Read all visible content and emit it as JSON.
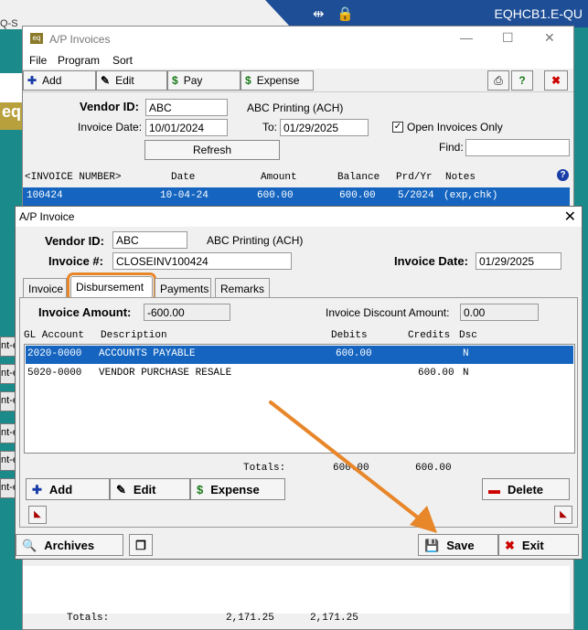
{
  "desktop": {
    "title": "EQHCB1.E-QU",
    "left_label": "Q-S",
    "left_gold": "eq",
    "side_tabs": [
      "nt-e",
      "nt-e",
      "nt-e",
      "nt-e",
      "nt-e",
      "nt-e"
    ]
  },
  "main_window": {
    "title": "A/P Invoices",
    "menu": [
      "File",
      "Program",
      "Sort"
    ],
    "toolbar": {
      "add": "Add",
      "edit": "Edit",
      "pay": "Pay",
      "expense": "Expense"
    },
    "vendor_id_label": "Vendor ID:",
    "vendor_id": "ABC",
    "vendor_name": "ABC Printing (ACH)",
    "invoice_date_label": "Invoice Date:",
    "invoice_date_from": "10/01/2024",
    "to_label": "To:",
    "invoice_date_to": "01/29/2025",
    "open_only_label": "Open Invoices Only",
    "open_only_checked": true,
    "refresh_label": "Refresh",
    "find_label": "Find:",
    "find_value": "",
    "columns": [
      "<INVOICE NUMBER>",
      "Date",
      "Amount",
      "Balance",
      "Prd/Yr",
      "Notes"
    ],
    "rows": [
      {
        "invoice": "100424",
        "date": "10-04-24",
        "amount": "600.00",
        "balance": "600.00",
        "prdyr": "5/2024",
        "notes": "(exp,chk)"
      }
    ],
    "totals_label": "Totals:",
    "totals_amount": "2,171.25",
    "totals_balance": "2,171.25"
  },
  "dialog": {
    "title": "A/P Invoice",
    "vendor_id_label": "Vendor ID:",
    "vendor_id": "ABC",
    "vendor_name": "ABC Printing (ACH)",
    "invoice_no_label": "Invoice #:",
    "invoice_no": "CLOSEINV100424",
    "invoice_date_label": "Invoice Date:",
    "invoice_date": "01/29/2025",
    "tabs": [
      "Invoice",
      "Disbursement",
      "Payments",
      "Remarks"
    ],
    "active_tab": "Disbursement",
    "invoice_amount_label": "Invoice Amount:",
    "invoice_amount": "-600.00",
    "discount_label": "Invoice Discount Amount:",
    "discount_amount": "0.00",
    "columns": [
      "GL Account",
      "Description",
      "Debits",
      "Credits",
      "Dsc"
    ],
    "rows": [
      {
        "gl": "2020-0000",
        "desc": "ACCOUNTS PAYABLE",
        "debit": "600.00",
        "credit": "",
        "dsc": "N"
      },
      {
        "gl": "5020-0000",
        "desc": "VENDOR PURCHASE RESALE",
        "debit": "",
        "credit": "600.00",
        "dsc": "N"
      }
    ],
    "totals_label": "Totals:",
    "totals_debits": "600.00",
    "totals_credits": "600.00",
    "buttons": {
      "add": "Add",
      "edit": "Edit",
      "expense": "Expense",
      "delete": "Delete"
    },
    "footer": {
      "archives": "Archives",
      "save": "Save",
      "exit": "Exit"
    }
  },
  "colors": {
    "selection": "#1565c0",
    "highlight": "#e8862a",
    "teal": "#1a8a8a"
  }
}
